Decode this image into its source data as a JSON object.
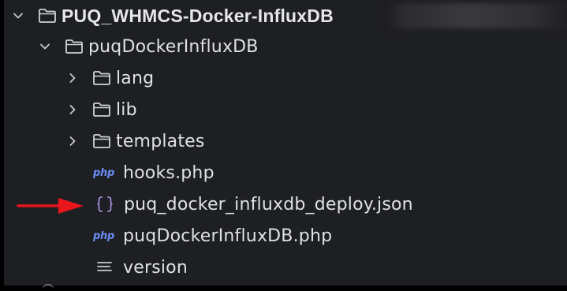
{
  "tree": {
    "root": {
      "label": "PUQ_WHMCS-Docker-InfluxDB",
      "expanded": true
    },
    "module_folder": {
      "label": "puqDockerInfluxDB",
      "expanded": true
    },
    "folders": [
      {
        "label": "lang",
        "expanded": false
      },
      {
        "label": "lib",
        "expanded": false
      },
      {
        "label": "templates",
        "expanded": false
      }
    ],
    "files": [
      {
        "label": "hooks.php",
        "icon": "php-icon",
        "icon_text": "php"
      },
      {
        "label": "puq_docker_influxdb_deploy.json",
        "icon": "json-icon",
        "icon_text": "{}"
      },
      {
        "label": "puqDockerInfluxDB.php",
        "icon": "php-icon",
        "icon_text": "php"
      },
      {
        "label": "version",
        "icon": "text-file-icon"
      }
    ]
  },
  "annotation": {
    "color": "#e8161b",
    "points_to": "puq_docker_influxdb_deploy.json"
  },
  "colors": {
    "background": "#1e1f22",
    "text": "#dfe1e5",
    "php_icon": "#6b8ef5",
    "json_icon": "#a98fe0"
  }
}
